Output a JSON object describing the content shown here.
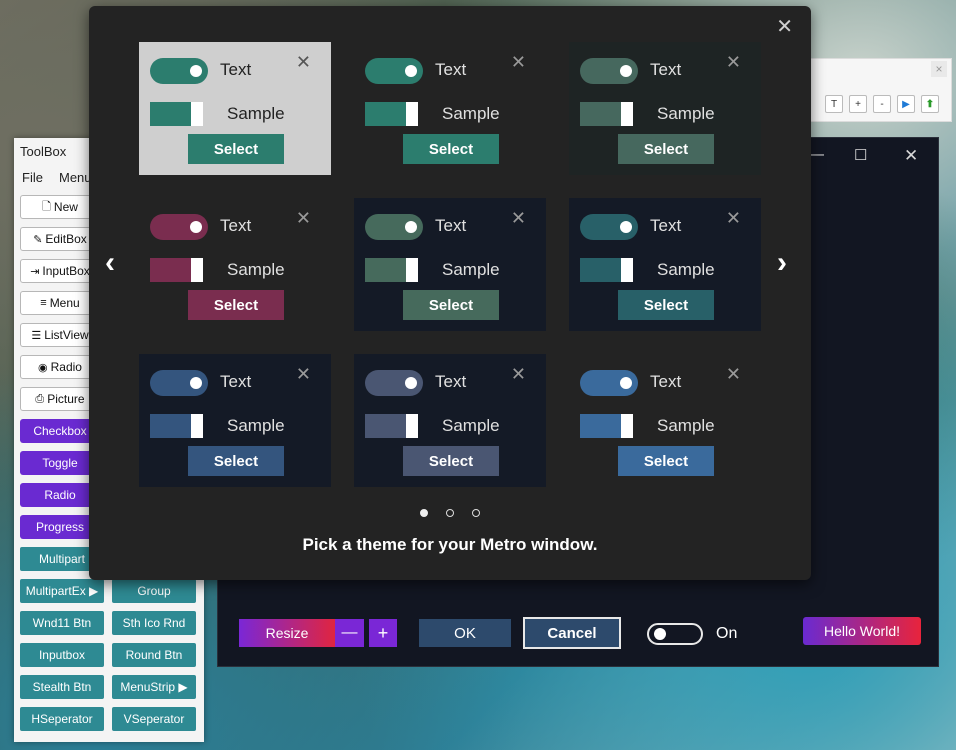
{
  "toolbox": {
    "title": "ToolBox",
    "menu": [
      "File",
      "Menu"
    ],
    "white_buttons": [
      {
        "icon": "new-document-icon",
        "glyph": "🗋",
        "label": "New"
      },
      {
        "icon": "editbox-icon",
        "glyph": "✎",
        "label": "EditBox"
      },
      {
        "icon": "inputbox-icon",
        "glyph": "⇥",
        "label": "InputBox"
      },
      {
        "icon": "menu-icon",
        "glyph": "≡",
        "label": "Menu"
      },
      {
        "icon": "listview-icon",
        "glyph": "☰",
        "label": "ListView"
      },
      {
        "icon": "radio-icon",
        "glyph": "◉",
        "label": "Radio"
      },
      {
        "icon": "picture-icon",
        "glyph": "⎙",
        "label": "Picture"
      }
    ],
    "purple_buttons": [
      "Checkbox",
      "Toggle",
      "Radio",
      "Progress"
    ],
    "teal_buttons": [
      [
        "Multipart",
        ""
      ],
      [
        "MultipartEx ▶",
        "Group"
      ],
      [
        "Wnd11 Btn",
        "Sth Ico Rnd"
      ],
      [
        "Inputbox",
        "Round Btn"
      ],
      [
        "Stealth Btn",
        "MenuStrip ▶"
      ],
      [
        "HSeperator",
        "VSeperator"
      ]
    ]
  },
  "minitool": {
    "close": "×",
    "buttons": [
      "T",
      "+",
      "-",
      "▶",
      "⬆"
    ]
  },
  "backwin": {
    "minimize": "—",
    "maximize": "☐",
    "close": "✕",
    "resize_label": "Resize",
    "minus": "—",
    "plus": "+",
    "ok": "OK",
    "cancel": "Cancel",
    "toggle_label": "On",
    "hello": "Hello World!"
  },
  "dialog": {
    "close": "✕",
    "prev": "‹",
    "next": "›",
    "caption": "Pick a theme for your Metro window.",
    "page": 1,
    "pages": 3,
    "cards": [
      {
        "name": "theme-light-teal",
        "toggle_text": "Text",
        "sample": "Sample",
        "select": "Select",
        "close": "✕",
        "bg": "#cfcfcf",
        "accent": "#2c7d6e",
        "text_color": "#222222",
        "close_color": "#555555"
      },
      {
        "name": "theme-dark-teal",
        "toggle_text": "Text",
        "sample": "Sample",
        "select": "Select",
        "close": "✕",
        "bg": "#232323",
        "accent": "#2c7d6e",
        "text_color": "#e0e0e0",
        "close_color": "#9a9a9a"
      },
      {
        "name": "theme-slate-green",
        "toggle_text": "Text",
        "sample": "Sample",
        "select": "Select",
        "close": "✕",
        "bg": "#1e2424",
        "accent": "#46685e",
        "text_color": "#e0e0e0",
        "close_color": "#9a9a9a"
      },
      {
        "name": "theme-dark-magenta",
        "toggle_text": "Text",
        "sample": "Sample",
        "select": "Select",
        "close": "✕",
        "bg": "#232323",
        "accent": "#7a2d4f",
        "text_color": "#e0e0e0",
        "close_color": "#9a9a9a"
      },
      {
        "name": "theme-navy-green",
        "toggle_text": "Text",
        "sample": "Sample",
        "select": "Select",
        "close": "✕",
        "bg": "#141a26",
        "accent": "#466a5c",
        "text_color": "#e0e0e0",
        "close_color": "#9a9a9a"
      },
      {
        "name": "theme-navy-teal",
        "toggle_text": "Text",
        "sample": "Sample",
        "select": "Select",
        "close": "✕",
        "bg": "#141a26",
        "accent": "#286068",
        "text_color": "#e0e0e0",
        "close_color": "#9a9a9a"
      },
      {
        "name": "theme-navy-blue",
        "toggle_text": "Text",
        "sample": "Sample",
        "select": "Select",
        "close": "✕",
        "bg": "#141a26",
        "accent": "#34557e",
        "text_color": "#e0e0e0",
        "close_color": "#9a9a9a"
      },
      {
        "name": "theme-navy-slate",
        "toggle_text": "Text",
        "sample": "Sample",
        "select": "Select",
        "close": "✕",
        "bg": "#141a26",
        "accent": "#4a5672",
        "text_color": "#e0e0e0",
        "close_color": "#9a9a9a"
      },
      {
        "name": "theme-dark-blue",
        "toggle_text": "Text",
        "sample": "Sample",
        "select": "Select",
        "close": "✕",
        "bg": "#232323",
        "accent": "#3a6a9c",
        "text_color": "#e0e0e0",
        "close_color": "#9a9a9a"
      }
    ]
  }
}
